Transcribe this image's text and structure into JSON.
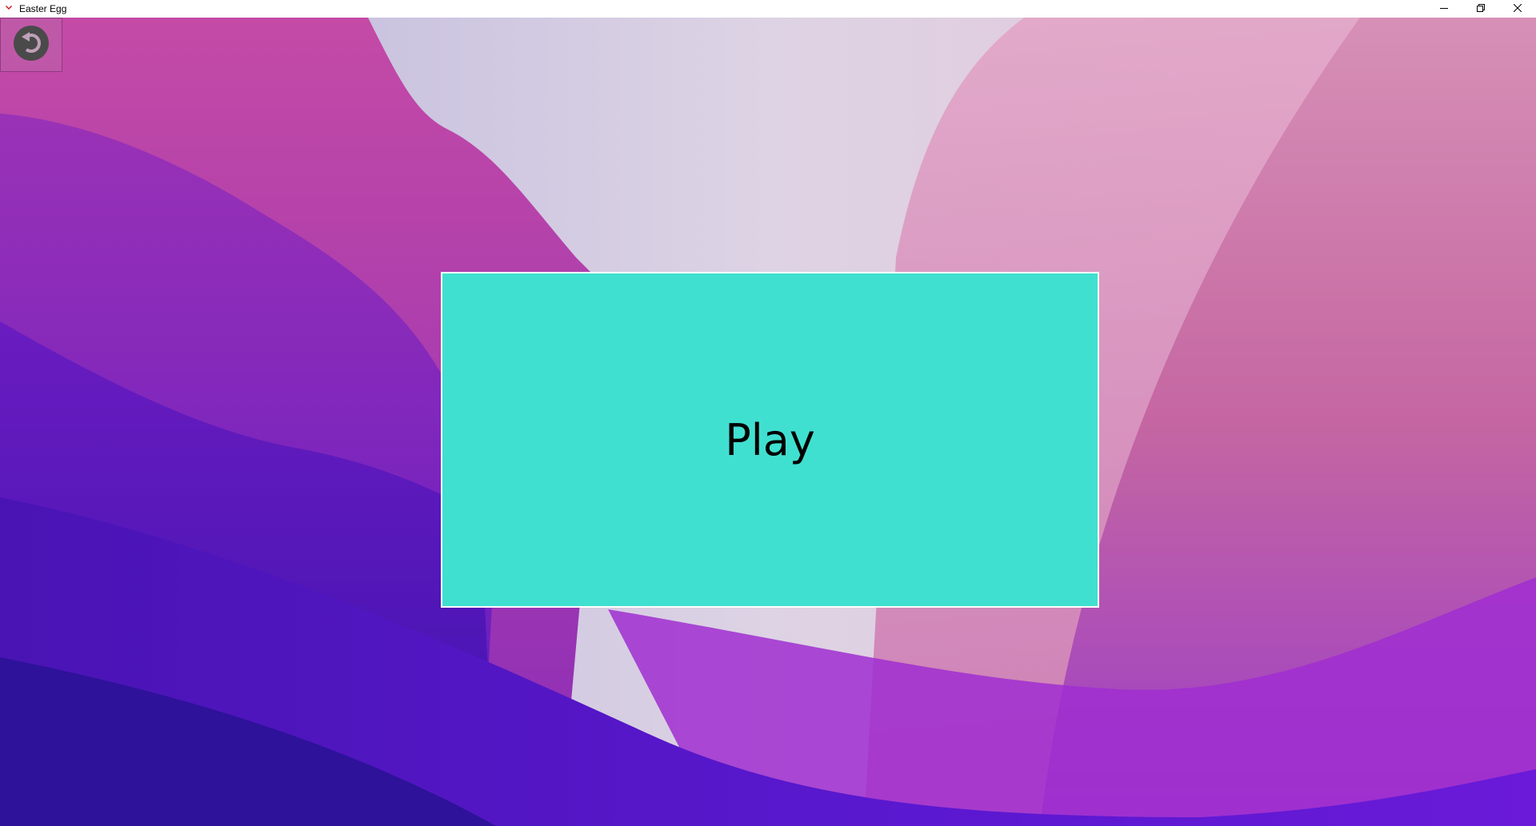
{
  "window": {
    "title": "Easter Egg",
    "app_icon": "heart-icon",
    "controls": [
      "minimize-icon",
      "restore-icon",
      "close-icon"
    ]
  },
  "main": {
    "back_icon": "undo-arrow-icon",
    "play_label": "Play"
  },
  "colors": {
    "play_button": "#40e0d0",
    "play_border": "#ffffff",
    "label_text": "#000000",
    "back_icon": "#4a4a4a"
  }
}
